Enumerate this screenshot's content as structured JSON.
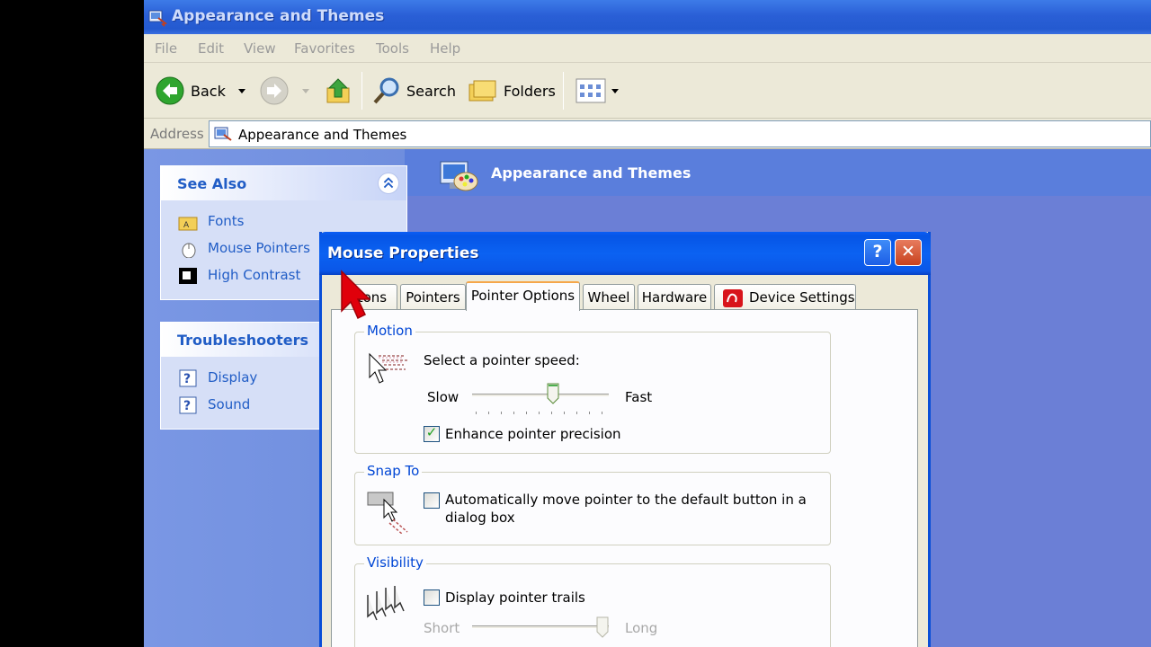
{
  "window": {
    "title": "Appearance and Themes"
  },
  "menu": [
    "File",
    "Edit",
    "View",
    "Favorites",
    "Tools",
    "Help"
  ],
  "toolbar": {
    "back_label": "Back",
    "search_label": "Search",
    "folders_label": "Folders"
  },
  "address": {
    "label": "Address",
    "value": "Appearance and Themes"
  },
  "content": {
    "heading": "Appearance and Themes"
  },
  "see_also": {
    "title": "See Also",
    "items": [
      {
        "label": "Fonts",
        "icon": "folder-icon"
      },
      {
        "label": "Mouse Pointers",
        "icon": "mouse-icon"
      },
      {
        "label": "High Contrast",
        "icon": "contrast-icon"
      }
    ]
  },
  "troubleshooters": {
    "title": "Troubleshooters",
    "items": [
      {
        "label": "Display",
        "icon": "help-icon"
      },
      {
        "label": "Sound",
        "icon": "help-icon"
      }
    ]
  },
  "dialog": {
    "title": "Mouse Properties",
    "help_glyph": "?",
    "close_glyph": "✕",
    "tabs": [
      "ttons",
      "Pointers",
      "Pointer Options",
      "Wheel",
      "Hardware",
      "Device Settings"
    ],
    "active_tab": "Pointer Options",
    "motion": {
      "legend": "Motion",
      "prompt": "Select a pointer speed:",
      "slow_label": "Slow",
      "fast_label": "Fast",
      "speed_fraction": 0.6,
      "enhance_label": "Enhance pointer precision",
      "enhance_checked": true
    },
    "snap_to": {
      "legend": "Snap To",
      "line1": "Automatically move pointer to the default button in a",
      "line2": "dialog box",
      "checked": false
    },
    "visibility": {
      "legend": "Visibility",
      "trails_label": "Display pointer trails",
      "trails_checked": false,
      "short_label": "Short",
      "long_label": "Long",
      "trail_fraction": 1.0
    }
  },
  "colors": {
    "accent": "#215dc6",
    "dialog_title": "#0a5df4",
    "legend": "#0046d5"
  }
}
